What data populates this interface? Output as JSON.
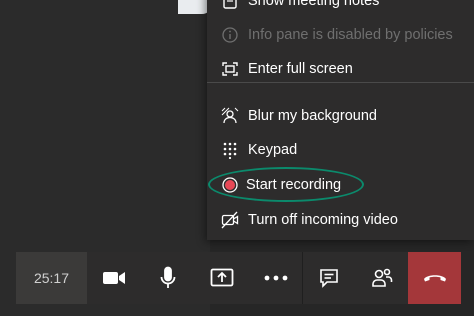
{
  "menu": {
    "items": [
      {
        "label": "Show meeting notes",
        "icon": "notes-icon",
        "disabled": false
      },
      {
        "label": "Info pane is disabled by policies",
        "icon": "info-icon",
        "disabled": true
      },
      {
        "label": "Enter full screen",
        "icon": "fullscreen-icon",
        "disabled": false
      },
      {
        "label": "Blur my background",
        "icon": "blur-background-icon",
        "disabled": false
      },
      {
        "label": "Keypad",
        "icon": "keypad-icon",
        "disabled": false
      },
      {
        "label": "Start recording",
        "icon": "record-icon",
        "disabled": false
      },
      {
        "label": "Turn off incoming video",
        "icon": "video-off-icon",
        "disabled": false
      }
    ]
  },
  "callbar": {
    "timer": "25:17",
    "buttons": [
      {
        "name": "camera",
        "icon": "camera-icon"
      },
      {
        "name": "microphone",
        "icon": "microphone-icon"
      },
      {
        "name": "share",
        "icon": "share-screen-icon"
      },
      {
        "name": "more",
        "icon": "more-options-icon"
      },
      {
        "name": "chat",
        "icon": "chat-icon"
      },
      {
        "name": "participants",
        "icon": "participants-icon"
      },
      {
        "name": "hang-up",
        "icon": "hang-up-icon"
      }
    ]
  },
  "colors": {
    "accent_ring": "#0b8a6c",
    "record_red": "#e74856",
    "hangup_bg": "#a4373a",
    "menu_bg": "#2d2c2c",
    "disabled_text": "#6f6f6f"
  }
}
